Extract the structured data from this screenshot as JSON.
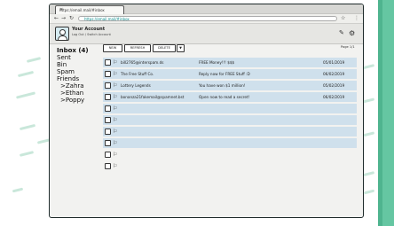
{
  "browser": {
    "tab_title": "https://email.mail/#inbox",
    "url": "https://email.mail/#inbox"
  },
  "account": {
    "title": "Your Account",
    "subtitle": "Log Out / Switch Account"
  },
  "folders": [
    {
      "label": "Inbox (4)",
      "level": 0,
      "bold": true
    },
    {
      "label": "Sent",
      "level": 0,
      "bold": false
    },
    {
      "label": "Bin",
      "level": 0,
      "bold": false
    },
    {
      "label": "Spam",
      "level": 0,
      "bold": false
    },
    {
      "label": "Friends",
      "level": 0,
      "bold": false
    },
    {
      "label": ">Zahra",
      "level": 1,
      "bold": false
    },
    {
      "label": ">Ethan",
      "level": 1,
      "bold": false
    },
    {
      "label": ">Poppy",
      "level": 1,
      "bold": false
    }
  ],
  "toolbar": {
    "new_label": "NEW",
    "refresh_label": "REFRESH",
    "delete_label": "DELETE",
    "more_symbol": "▼",
    "pager": "Page 1/1"
  },
  "emails": [
    {
      "from": "bill2765@interspam.ds",
      "subject": "FREE Money!!! $$$",
      "date": "05/01/2019"
    },
    {
      "from": "The Free Stuff Co.",
      "subject": "Reply now for FREE Stuff :D",
      "date": "06/02/2019"
    },
    {
      "from": "Lottery Legends",
      "subject": "You have won $1 million!",
      "date": "05/02/2019"
    },
    {
      "from": "bonanza21fakemail@spamnet.bst",
      "subject": "Open now to read a secret!",
      "date": "06/02/2019"
    },
    {
      "from": "",
      "subject": "",
      "date": ""
    },
    {
      "from": "",
      "subject": "",
      "date": ""
    },
    {
      "from": "",
      "subject": "",
      "date": ""
    },
    {
      "from": "",
      "subject": "",
      "date": ""
    },
    {
      "from": "",
      "subject": "",
      "date": ""
    },
    {
      "from": "",
      "subject": "",
      "date": ""
    }
  ],
  "icons": {
    "compose": "compose-icon",
    "settings": "gear-icon",
    "flag": "flag-icon",
    "bookmark": "star-icon"
  },
  "colors": {
    "row_fill": "#cfe0ec",
    "accent_green": "#4fb48f"
  }
}
